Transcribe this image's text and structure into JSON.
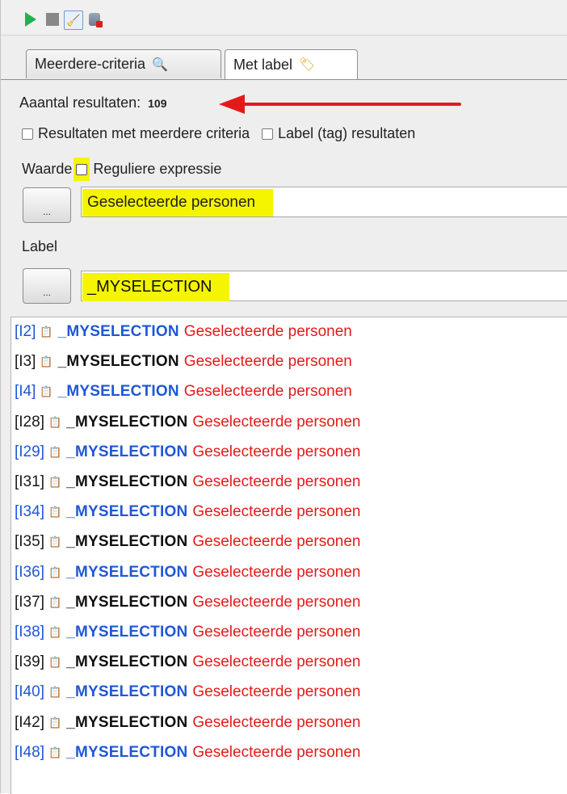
{
  "toolbar": {
    "icons": [
      "play-icon",
      "stop-icon",
      "broom-icon",
      "database-delete-icon"
    ],
    "colors": {
      "play": "#22b14c",
      "stop": "#888888"
    }
  },
  "tabs": [
    {
      "label": "Meerdere-criteria",
      "icon": "magnifier-icon",
      "active": false
    },
    {
      "label": "Met label",
      "icon": "tag-search-icon",
      "active": true
    }
  ],
  "result_count": {
    "label": "Aaantal resultaten:",
    "value": "109"
  },
  "options": {
    "multi_criteria": "Resultaten met meerdere criteria",
    "label_results": "Label (tag) resultaten"
  },
  "waarde": {
    "label": "Waarde",
    "regex": "Reguliere expressie",
    "button": "...",
    "value": "Geselecteerde personen"
  },
  "label_section": {
    "label": "Label",
    "button": "...",
    "value": "_MYSELECTION"
  },
  "colors": {
    "highlight": "#f5f500",
    "link_blue": "#1f57d6",
    "value_red": "#e41a1a",
    "arrow": "#e41a1a"
  },
  "results": [
    {
      "id": "[I2]",
      "label": "_MYSELECTION",
      "value": "Geselecteerde personen",
      "alt": true
    },
    {
      "id": "[I3]",
      "label": "_MYSELECTION",
      "value": "Geselecteerde personen",
      "alt": false
    },
    {
      "id": "[I4]",
      "label": "_MYSELECTION",
      "value": "Geselecteerde personen",
      "alt": true
    },
    {
      "id": "[I28]",
      "label": "_MYSELECTION",
      "value": "Geselecteerde personen",
      "alt": false
    },
    {
      "id": "[I29]",
      "label": "_MYSELECTION",
      "value": "Geselecteerde personen",
      "alt": true
    },
    {
      "id": "[I31]",
      "label": "_MYSELECTION",
      "value": "Geselecteerde personen",
      "alt": false
    },
    {
      "id": "[I34]",
      "label": "_MYSELECTION",
      "value": "Geselecteerde personen",
      "alt": true
    },
    {
      "id": "[I35]",
      "label": "_MYSELECTION",
      "value": "Geselecteerde personen",
      "alt": false
    },
    {
      "id": "[I36]",
      "label": "_MYSELECTION",
      "value": "Geselecteerde personen",
      "alt": true
    },
    {
      "id": "[I37]",
      "label": "_MYSELECTION",
      "value": "Geselecteerde personen",
      "alt": false
    },
    {
      "id": "[I38]",
      "label": "_MYSELECTION",
      "value": "Geselecteerde personen",
      "alt": true
    },
    {
      "id": "[I39]",
      "label": "_MYSELECTION",
      "value": "Geselecteerde personen",
      "alt": false
    },
    {
      "id": "[I40]",
      "label": "_MYSELECTION",
      "value": "Geselecteerde personen",
      "alt": true
    },
    {
      "id": "[I42]",
      "label": "_MYSELECTION",
      "value": "Geselecteerde personen",
      "alt": false
    },
    {
      "id": "[I48]",
      "label": "_MYSELECTION",
      "value": "Geselecteerde personen",
      "alt": true
    }
  ]
}
